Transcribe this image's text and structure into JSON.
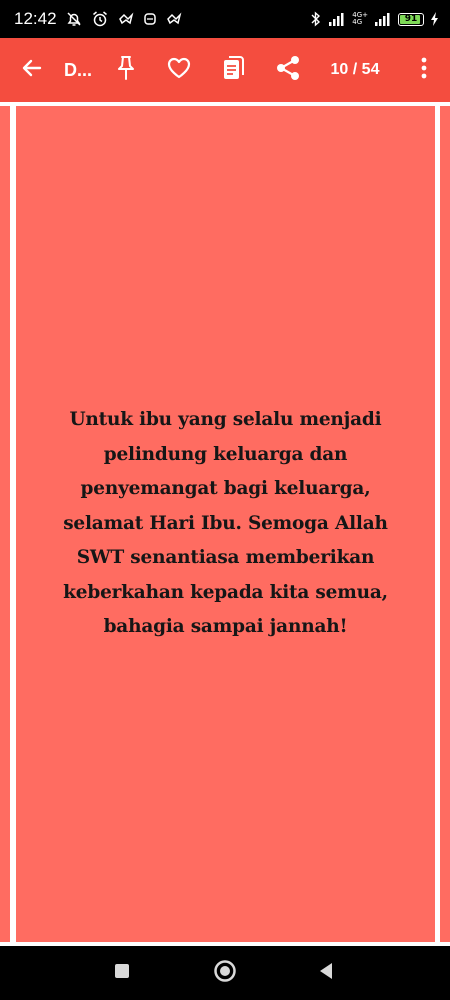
{
  "status_bar": {
    "time": "12:42",
    "network": "4G+",
    "network_sub": "4G",
    "battery": "91"
  },
  "app_bar": {
    "title": "D...",
    "counter": "10 / 54",
    "icons": [
      "back-arrow-icon",
      "pin-icon",
      "heart-icon",
      "copy-icon",
      "share-icon",
      "more-vert-icon"
    ],
    "color": "#f44d3f"
  },
  "card": {
    "text": "Untuk ibu yang selalu menjadi pelindung keluarga dan penyemangat bagi keluarga, selamat Hari Ibu. Semoga Allah SWT senantiasa memberikan keberkahan kepada kita semua, bahagia sampai jannah!",
    "color": "#ff6c61"
  },
  "nav_bar": {
    "icons": [
      "recents-square-icon",
      "home-circle-icon",
      "back-triangle-icon"
    ]
  }
}
